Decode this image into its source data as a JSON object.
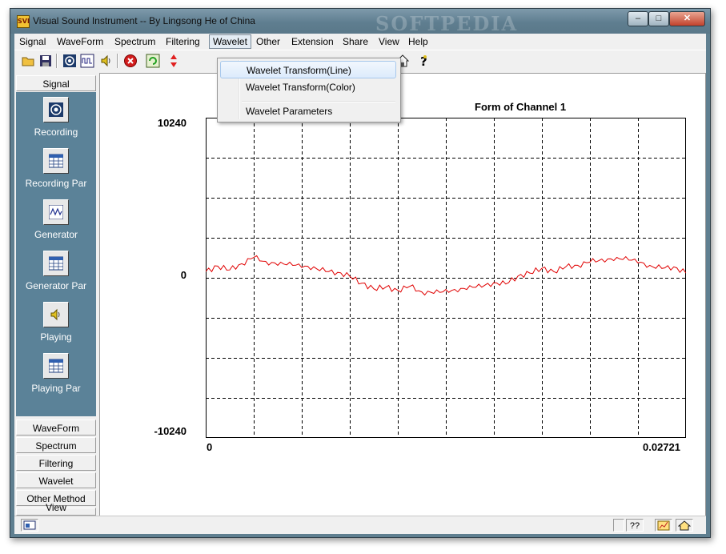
{
  "window": {
    "title": "Visual Sound Instrument -- By Lingsong He of China",
    "watermark": "SOFTPEDIA",
    "controls": {
      "minimize": "–",
      "maximize": "□",
      "close": "✕"
    }
  },
  "menubar": {
    "items": [
      "Signal",
      "WaveForm",
      "Spectrum",
      "Filtering",
      "Wavelet",
      "Other",
      "Extension",
      "Share",
      "View",
      "Help"
    ],
    "active": "Wavelet"
  },
  "wavelet_menu": {
    "items": [
      "Wavelet Transform(Line)",
      "Wavelet Transform(Color)",
      "Wavelet Parameters"
    ],
    "highlighted": "Wavelet Transform(Line)"
  },
  "toolbar": {
    "icons": [
      "open-folder-icon",
      "save-icon",
      "record-icon",
      "waveform-icon",
      "speaker-icon",
      "stop-icon",
      "refresh-icon",
      "arrows-icon",
      "home-icon",
      "help-icon"
    ]
  },
  "sidebar": {
    "groups": [
      "Signal",
      "WaveForm",
      "Spectrum",
      "Filtering",
      "Wavelet",
      "Other Method",
      "View"
    ],
    "signal_items": [
      {
        "label": "Recording",
        "icon": "record-icon"
      },
      {
        "label": "Recording Par",
        "icon": "grid-icon"
      },
      {
        "label": "Generator",
        "icon": "generator-icon"
      },
      {
        "label": "Generator Par",
        "icon": "grid-icon"
      },
      {
        "label": "Playing",
        "icon": "speaker-icon"
      },
      {
        "label": "Playing Par",
        "icon": "grid-icon"
      }
    ]
  },
  "chart_data": {
    "type": "line",
    "title": "Form of Channel 1",
    "xlim": [
      0,
      0.02721
    ],
    "ylim": [
      -10240,
      10240
    ],
    "ytick_labels": [
      "10240",
      "0",
      "-10240"
    ],
    "xtick_labels": [
      "0",
      "0.02721"
    ],
    "grid": true,
    "color": "#e00000",
    "series": [
      {
        "x": [
          0,
          0.00068,
          0.00136,
          0.00204,
          0.00272,
          0.0034,
          0.00408,
          0.00476,
          0.00544,
          0.00612,
          0.0068,
          0.00748,
          0.00816,
          0.00884,
          0.00952,
          0.0102,
          0.01088,
          0.01156,
          0.01224,
          0.01292,
          0.0136,
          0.01428,
          0.01496,
          0.01564,
          0.01632,
          0.017,
          0.01768,
          0.01836,
          0.01904,
          0.01972,
          0.0204,
          0.02108,
          0.02176,
          0.02244,
          0.02312,
          0.0238,
          0.02448,
          0.02516,
          0.02584,
          0.02652,
          0.02721
        ],
        "values": [
          400,
          750,
          500,
          900,
          1300,
          1050,
          800,
          1000,
          650,
          700,
          400,
          350,
          100,
          -350,
          -700,
          -600,
          -800,
          -550,
          -900,
          -1000,
          -750,
          -900,
          -500,
          -600,
          -300,
          -400,
          100,
          300,
          600,
          400,
          700,
          800,
          1000,
          1200,
          1100,
          1350,
          950,
          800,
          600,
          700,
          300
        ]
      }
    ]
  },
  "statusbar": {
    "help": "??"
  }
}
